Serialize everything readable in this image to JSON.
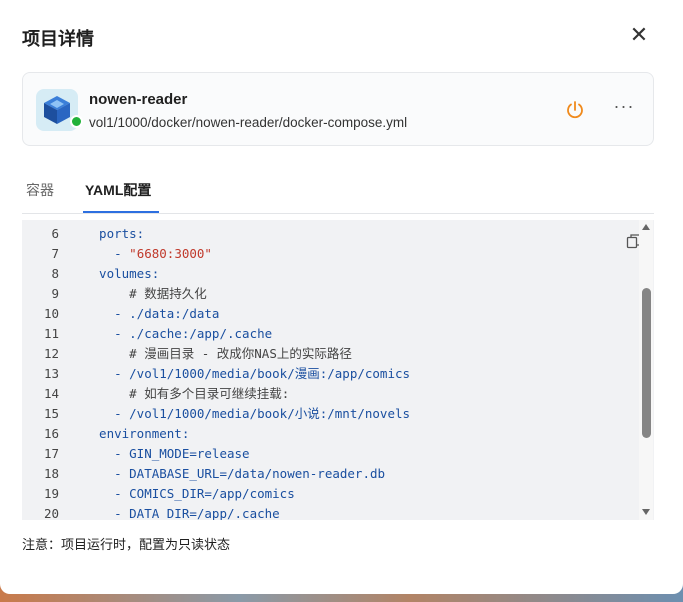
{
  "dialog": {
    "title": "项目详情",
    "close_icon": "close-icon"
  },
  "project": {
    "name": "nowen-reader",
    "path": "vol1/1000/docker/nowen-reader/docker-compose.yml",
    "status_color": "#21b23a",
    "power_color": "#f08a1c"
  },
  "tabs": [
    {
      "label": "容器"
    },
    {
      "label": "YAML配置"
    }
  ],
  "editor": {
    "lines": [
      {
        "num": "6",
        "indent": "  ",
        "text": "ports:",
        "type": "key"
      },
      {
        "num": "7",
        "indent": "    ",
        "text": "- \"6680:3000\"",
        "type": "str"
      },
      {
        "num": "8",
        "indent": "  ",
        "text": "volumes:",
        "type": "key"
      },
      {
        "num": "9",
        "indent": "      ",
        "text": "# 数据持久化",
        "type": "cmt"
      },
      {
        "num": "10",
        "indent": "    ",
        "text": "- ./data:/data",
        "type": "key"
      },
      {
        "num": "11",
        "indent": "    ",
        "text": "- ./cache:/app/.cache",
        "type": "key"
      },
      {
        "num": "12",
        "indent": "      ",
        "text": "# 漫画目录 - 改成你NAS上的实际路径",
        "type": "cmt"
      },
      {
        "num": "13",
        "indent": "    ",
        "text": "- /vol1/1000/media/book/漫画:/app/comics",
        "type": "key"
      },
      {
        "num": "14",
        "indent": "      ",
        "text": "# 如有多个目录可继续挂载:",
        "type": "cmt"
      },
      {
        "num": "15",
        "indent": "    ",
        "text": "- /vol1/1000/media/book/小说:/mnt/novels",
        "type": "key"
      },
      {
        "num": "16",
        "indent": "  ",
        "text": "environment:",
        "type": "key"
      },
      {
        "num": "17",
        "indent": "    ",
        "text": "- GIN_MODE=release",
        "type": "key"
      },
      {
        "num": "18",
        "indent": "    ",
        "text": "- DATABASE_URL=/data/nowen-reader.db",
        "type": "key"
      },
      {
        "num": "19",
        "indent": "    ",
        "text": "- COMICS_DIR=/app/comics",
        "type": "key"
      },
      {
        "num": "20",
        "indent": "    ",
        "text": "- DATA_DIR=/app/.cache",
        "type": "key"
      }
    ]
  },
  "note": "注意：项目运行时，配置为只读状态"
}
